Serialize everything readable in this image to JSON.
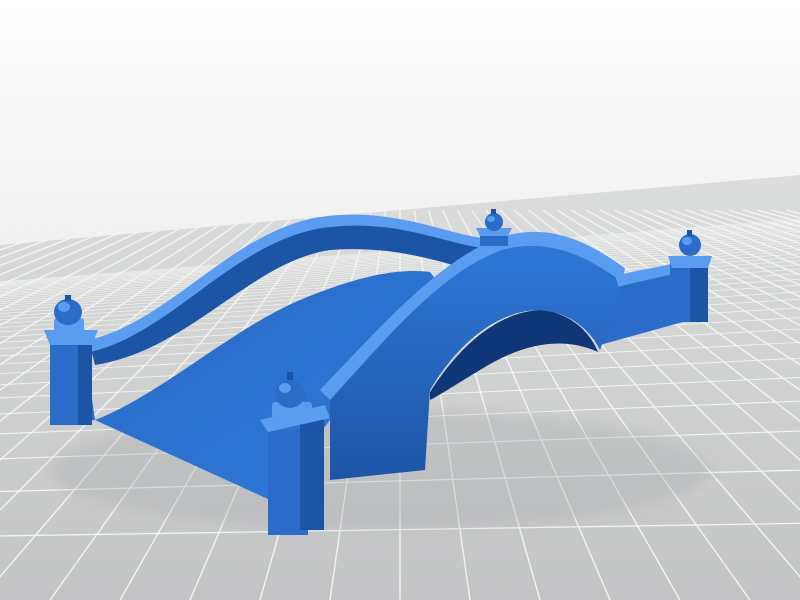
{
  "scene": {
    "subject": "arched-bridge-3d-model",
    "colors": {
      "sky_top": "#ffffff",
      "sky_bottom": "#d9dadb",
      "floor_near": "#c3c4c5",
      "floor_far": "#dcdddd",
      "grid_line": "#f2f3f3",
      "model_base": "#2f78d8",
      "model_light": "#5a9cf0",
      "model_mid": "#2a6cc8",
      "model_dark": "#1d55a6",
      "model_deep": "#0f3778",
      "shadow": "#a9abad"
    }
  }
}
